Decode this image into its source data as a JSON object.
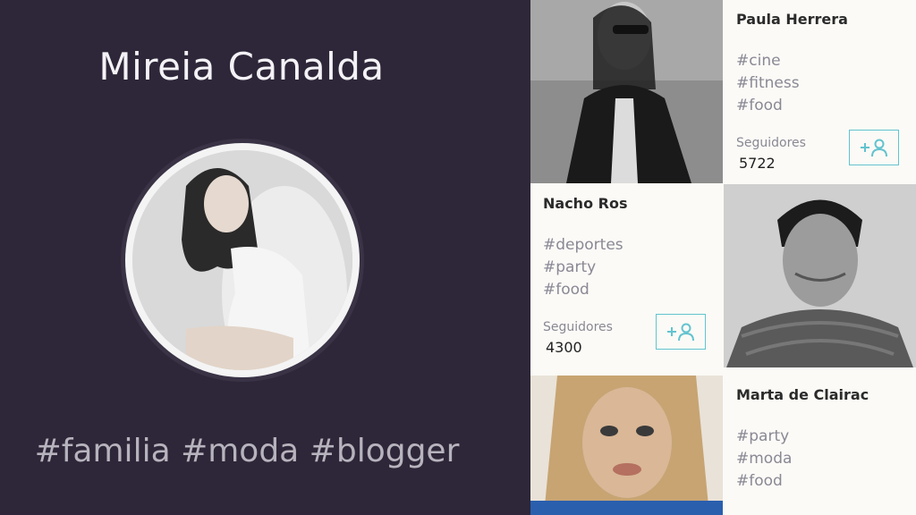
{
  "profile": {
    "name": "Mireia Canalda",
    "tags": "#familia #moda #blogger"
  },
  "suggestions": [
    {
      "name": "Paula Herrera",
      "tags": [
        "#cine",
        "#fitness",
        "#food"
      ],
      "followers_label": "Seguidores",
      "followers": "5722"
    },
    {
      "name": "Nacho Ros",
      "tags": [
        "#deportes",
        "#party",
        "#food"
      ],
      "followers_label": "Seguidores",
      "followers": "4300"
    },
    {
      "name": "Marta de Clairac",
      "tags": [
        "#party",
        "#moda",
        "#food"
      ]
    }
  ],
  "colors": {
    "panel_bg": "#2e2739",
    "card_bg": "#fbfaf6",
    "accent": "#63c3cf",
    "tag_text": "#8a8894"
  },
  "icons": {
    "follow_button": "add-user-icon"
  }
}
